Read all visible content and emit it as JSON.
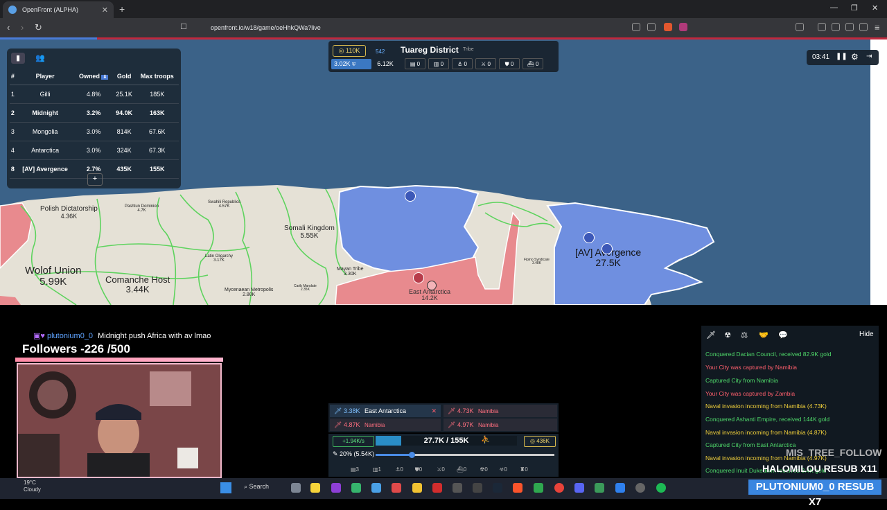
{
  "browser": {
    "tab_title": "OpenFront (ALPHA)",
    "url": "openfront.io/w18/game/oeHhkQWa?live"
  },
  "leaderboard": {
    "headers": [
      "#",
      "Player",
      "Owned",
      "Gold",
      "Max troops"
    ],
    "sort_icon": "⬇",
    "rows": [
      {
        "rank": "1",
        "player": "Gilli",
        "owned": "4.8%",
        "gold": "25.1K",
        "troops": "185K"
      },
      {
        "rank": "2",
        "player": "Midnight",
        "owned": "3.2%",
        "gold": "94.0K",
        "troops": "163K"
      },
      {
        "rank": "3",
        "player": "Mongolia",
        "owned": "3.0%",
        "gold": "814K",
        "troops": "67.6K"
      },
      {
        "rank": "4",
        "player": "Antarctica",
        "owned": "3.0%",
        "gold": "324K",
        "troops": "67.3K"
      },
      {
        "rank": "8",
        "player": "[AV] Avergence",
        "owned": "2.7%",
        "gold": "435K",
        "troops": "155K"
      }
    ],
    "expand_label": "+"
  },
  "info_panel": {
    "gold": "110K",
    "small_value": "542",
    "population": "3.02K",
    "troops": "6.12K",
    "title": "Tuareg District",
    "type": "Tribe",
    "stats": [
      "0",
      "0",
      "0",
      "0",
      "0",
      "0"
    ]
  },
  "timer": {
    "time": "03:41"
  },
  "map_labels": [
    {
      "name": "Polish Dictatorship",
      "value": "4.36K"
    },
    {
      "name": "Pashtun Dominion",
      "value": "4.7K"
    },
    {
      "name": "Swahili Republics",
      "value": "4.57K"
    },
    {
      "name": "Somali Kingdom",
      "value": "5.55K"
    },
    {
      "name": "Wolof Union",
      "value": "5.99K"
    },
    {
      "name": "Comanche Host",
      "value": "3.44K"
    },
    {
      "name": "Latin Oligarchy",
      "value": "3.17K"
    },
    {
      "name": "Mayan Tribe",
      "value": "3.30K"
    },
    {
      "name": "Mycenaean Metropolis",
      "value": "2.80K"
    },
    {
      "name": "Carib Mandate",
      "value": "2.35K"
    },
    {
      "name": "East Antarctica",
      "value": "14.2K"
    },
    {
      "name": "Fipino Syndicate",
      "value": "3.48K"
    },
    {
      "name": "[AV] Avergence",
      "value": "27.5K"
    }
  ],
  "stream": {
    "chat_name": "plutonium0_0",
    "chat_message": "Midnight push Africa with av lmao",
    "followers": "Followers -226 /500",
    "overlay_follow": "MIS_TREE_FOLLOW",
    "overlay_resub": "HALOMILOU RESUB X11",
    "overlay_badge": "PLUTONIUM0_0  RESUB X7"
  },
  "attacks": [
    {
      "troops": "3.38K",
      "target": "East Antarctica"
    },
    {
      "troops": "4.73K",
      "target": "Namibia"
    },
    {
      "troops": "4.87K",
      "target": "Namibia"
    },
    {
      "troops": "4.97K",
      "target": "Namibia"
    }
  ],
  "control": {
    "rate": "+1.94K/s",
    "troops": "27.7K / 155K",
    "troop_fill": 0.179,
    "gold": "436K",
    "ratio": "20% (5.54K)",
    "ratio_fill": 0.2,
    "builds": [
      "3",
      "1",
      "0",
      "0",
      "0",
      "0",
      "0",
      "0",
      "0"
    ]
  },
  "events": {
    "hide_label": "Hide",
    "items": [
      {
        "text": "Conquered Dacian Council, received 82.9K gold",
        "color": "#4fd86a"
      },
      {
        "text": "Your City was captured by Namibia",
        "color": "#ff5f6d"
      },
      {
        "text": "Captured City from Namibia",
        "color": "#4fd86a"
      },
      {
        "text": "Your City was captured by Zambia",
        "color": "#ff5f6d"
      },
      {
        "text": "Naval invasion incoming from Namibia (4.73K)",
        "color": "#f2d13b"
      },
      {
        "text": "Conquered Ashanti Empire, received 144K gold",
        "color": "#4fd86a"
      },
      {
        "text": "Naval invasion incoming from Namibia (4.87K)",
        "color": "#f2d13b"
      },
      {
        "text": "Captured City from East Antarctica",
        "color": "#4fd86a"
      },
      {
        "text": "Naval invasion incoming from Namibia (4.97K)",
        "color": "#f2d13b"
      },
      {
        "text": "Conquered Inuit Dukedom, received 3.4K gold",
        "color": "#4fd86a"
      }
    ]
  },
  "taskbar": {
    "weather_temp": "19°C",
    "weather_desc": "Cloudy",
    "search_label": "Search"
  }
}
